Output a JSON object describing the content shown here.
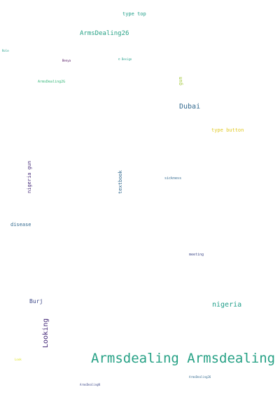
{
  "words": [
    {
      "text": "type top"
    },
    {
      "text": "ArmsDealing26"
    },
    {
      "text": "Role"
    },
    {
      "text": "Benya"
    },
    {
      "text": "© Design"
    },
    {
      "text": "ArmsDealing2G"
    },
    {
      "text": "gun"
    },
    {
      "text": "Dubai"
    },
    {
      "text": "type button"
    },
    {
      "text": "nigeria gun"
    },
    {
      "text": "textbook"
    },
    {
      "text": "sickness"
    },
    {
      "text": "disease"
    },
    {
      "text": "meeting"
    },
    {
      "text": "Burj"
    },
    {
      "text": "nigeria"
    },
    {
      "text": "Looking"
    },
    {
      "text": "Armsdealing Armsdealing"
    },
    {
      "text": "Look"
    },
    {
      "text": "ArmsDealingN"
    },
    {
      "text": "ArmsDealing26"
    }
  ],
  "colors": {
    "background": "#ffffff",
    "teal": "#1f9e89",
    "green": "#35b779",
    "blue": "#31688e",
    "indigo": "#3e4989",
    "purple": "#472c7a",
    "yellow": "#e0c822",
    "lime": "#a2c83a"
  }
}
